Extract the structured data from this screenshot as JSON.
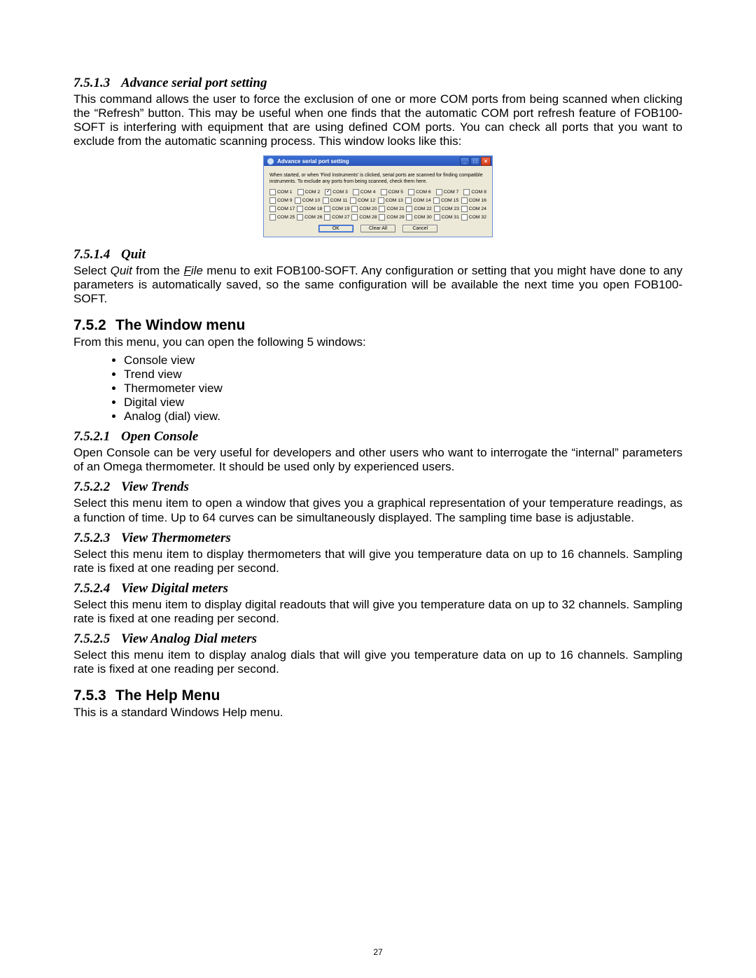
{
  "s1": {
    "num": "7.5.1.3",
    "title": "Advance serial port setting",
    "para": "This command allows the user to force the exclusion of one or more COM ports from being scanned when clicking the “Refresh” button. This may be useful when one finds that the automatic COM port refresh feature of FOB100-SOFT is interfering with equipment that are using defined COM ports. You can check all ports that you want to exclude from the automatic scanning process. This window looks like this:"
  },
  "dialog": {
    "title": "Advance serial port setting",
    "msg": "When started, or when 'Find Instruments' is clicked, serial ports are scanned for finding compatible instruments. To exclude any ports from being scanned, check them here.",
    "rows": [
      [
        {
          "label": "COM 1",
          "checked": false
        },
        {
          "label": "COM 2",
          "checked": false
        },
        {
          "label": "COM 3",
          "checked": true
        },
        {
          "label": "COM 4",
          "checked": false
        },
        {
          "label": "COM 5",
          "checked": false
        },
        {
          "label": "COM 6",
          "checked": false
        },
        {
          "label": "COM 7",
          "checked": false
        },
        {
          "label": "COM 8",
          "checked": false
        }
      ],
      [
        {
          "label": "COM 9",
          "checked": false
        },
        {
          "label": "COM 10",
          "checked": false
        },
        {
          "label": "COM 11",
          "checked": false
        },
        {
          "label": "COM 12",
          "checked": false
        },
        {
          "label": "COM 13",
          "checked": false
        },
        {
          "label": "COM 14",
          "checked": false
        },
        {
          "label": "COM 15",
          "checked": false
        },
        {
          "label": "COM 16",
          "checked": false
        }
      ],
      [
        {
          "label": "COM 17",
          "checked": false
        },
        {
          "label": "COM 18",
          "checked": false
        },
        {
          "label": "COM 19",
          "checked": false
        },
        {
          "label": "COM 20",
          "checked": false
        },
        {
          "label": "COM 21",
          "checked": false
        },
        {
          "label": "COM 22",
          "checked": false
        },
        {
          "label": "COM 23",
          "checked": false
        },
        {
          "label": "COM 24",
          "checked": false
        }
      ],
      [
        {
          "label": "COM 25",
          "checked": false
        },
        {
          "label": "COM 26",
          "checked": false
        },
        {
          "label": "COM 27",
          "checked": false
        },
        {
          "label": "COM 28",
          "checked": false
        },
        {
          "label": "COM 29",
          "checked": false
        },
        {
          "label": "COM 30",
          "checked": false
        },
        {
          "label": "COM 31",
          "checked": false
        },
        {
          "label": "COM 32",
          "checked": false
        }
      ]
    ],
    "buttons": {
      "ok": "OK",
      "clear": "Clear All",
      "cancel": "Cancel"
    }
  },
  "s2": {
    "num": "7.5.1.4",
    "title": "Quit",
    "pre": "Select ",
    "quit": "Quit",
    "mid": " from the ",
    "file_u": "F",
    "file_rest": "ile",
    "post": " menu to exit FOB100-SOFT. Any configuration or setting that you might have done to any parameters is automatically saved, so the same configuration will be available the next time you open FOB100-SOFT."
  },
  "s3": {
    "num": "7.5.2",
    "title": "The Window menu",
    "intro": "From this menu, you can open the following 5 windows:",
    "items": [
      "Console view",
      "Trend view",
      "Thermometer view",
      "Digital view",
      "Analog (dial) view."
    ]
  },
  "s4": {
    "num": "7.5.2.1",
    "title": "Open Console",
    "para": "Open Console can be very useful for developers and other users who want to interrogate the “internal” parameters of an Omega thermometer. It should be used only by experienced users."
  },
  "s5": {
    "num": "7.5.2.2",
    "title": "View Trends",
    "para": "Select this menu item to open a window that gives you a graphical representation of your temperature readings, as a function of time. Up to 64 curves can be simultaneously displayed. The sampling time base is adjustable."
  },
  "s6": {
    "num": "7.5.2.3",
    "title": "View Thermometers",
    "para": "Select this menu item to display thermometers that will give you temperature data on up to 16 channels. Sampling rate is fixed at one reading per second."
  },
  "s7": {
    "num": "7.5.2.4",
    "title": "View Digital meters",
    "para": "Select this menu item to display digital readouts that will give you temperature data on up to 32 channels. Sampling rate is fixed at one reading per second."
  },
  "s8": {
    "num": "7.5.2.5",
    "title": "View Analog Dial meters",
    "para": "Select this menu item to display analog dials that will give you temperature data on up to 16 channels. Sampling rate is fixed at one reading per second."
  },
  "s9": {
    "num": "7.5.3",
    "title": "The Help Menu",
    "para": "This is a standard Windows Help menu."
  },
  "pagenum": "27"
}
